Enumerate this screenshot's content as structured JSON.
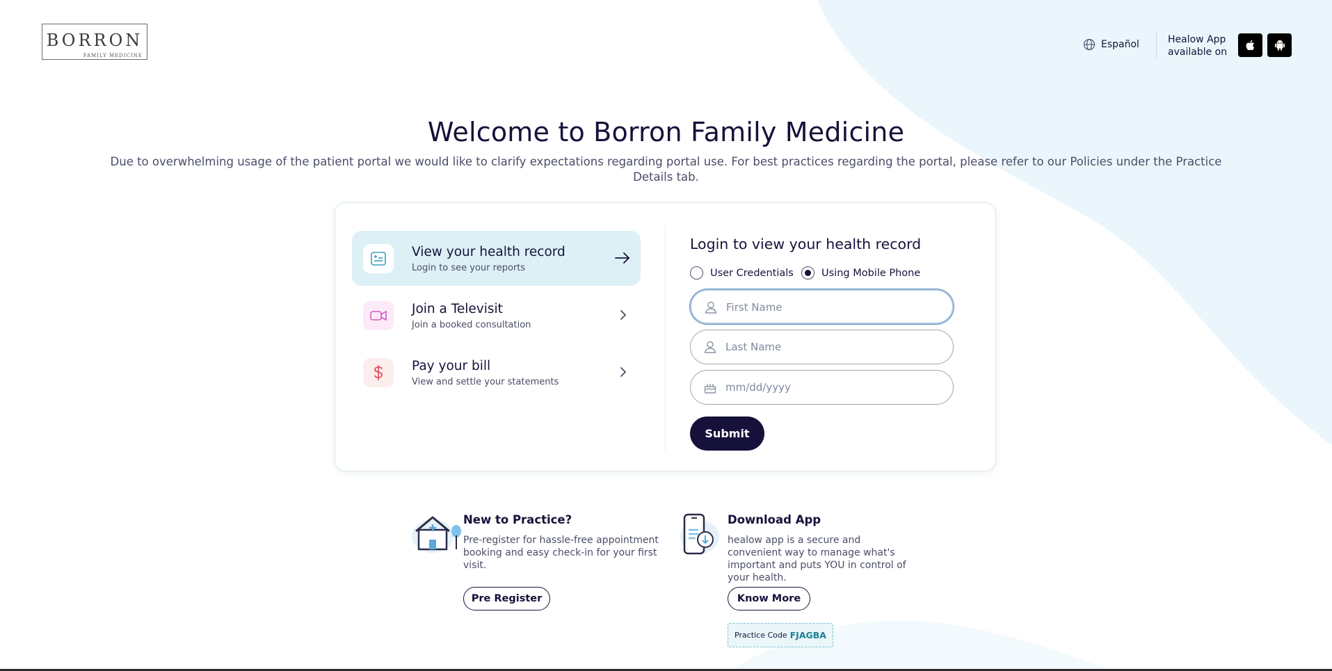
{
  "header": {
    "logo_name": "BORRON",
    "logo_sub": "FAMILY MEDICINE",
    "language_label": "Español",
    "app_text_line1": "Healow App",
    "app_text_line2": "available on",
    "apple_icon": "apple-icon",
    "android_icon": "android-icon"
  },
  "welcome": {
    "title": "Welcome to Borron Family Medicine",
    "description": "Due to overwhelming usage of the patient portal we would like to clarify expectations regarding portal use. For best practices regarding the portal, please refer to our Policies under the Practice Details tab."
  },
  "options": [
    {
      "title": "View your health record",
      "subtitle": "Login to see your reports",
      "icon": "health-record-icon",
      "active": true
    },
    {
      "title": "Join a Televisit",
      "subtitle": "Join a booked consultation",
      "icon": "video-camera-icon",
      "active": false
    },
    {
      "title": "Pay your bill",
      "subtitle": "View and settle your statements",
      "icon": "dollar-icon",
      "active": false
    }
  ],
  "login": {
    "title": "Login to view your health record",
    "radio_credentials": "User Credentials",
    "radio_mobile": "Using Mobile Phone",
    "selected": "Using Mobile Phone",
    "first_name_placeholder": "First Name",
    "last_name_placeholder": "Last Name",
    "dob_placeholder": "mm/dd/yyyy",
    "submit_label": "Submit"
  },
  "new_practice": {
    "title": "New to Practice?",
    "text": "Pre-register for hassle-free appointment booking and easy check-in for your first visit.",
    "button": "Pre Register"
  },
  "download_app": {
    "title": "Download App",
    "text": "healow app is a secure and convenient way to manage what's important and puts YOU in control of your health.",
    "button": "Know More",
    "practice_code_label": "Practice Code",
    "practice_code_value": "FJAGBA"
  },
  "colors": {
    "primary": "#15113a",
    "active_option_bg": "#dcf0f6",
    "wave_bg": "#eaf6fb",
    "accent_teal": "#1d7f96"
  }
}
